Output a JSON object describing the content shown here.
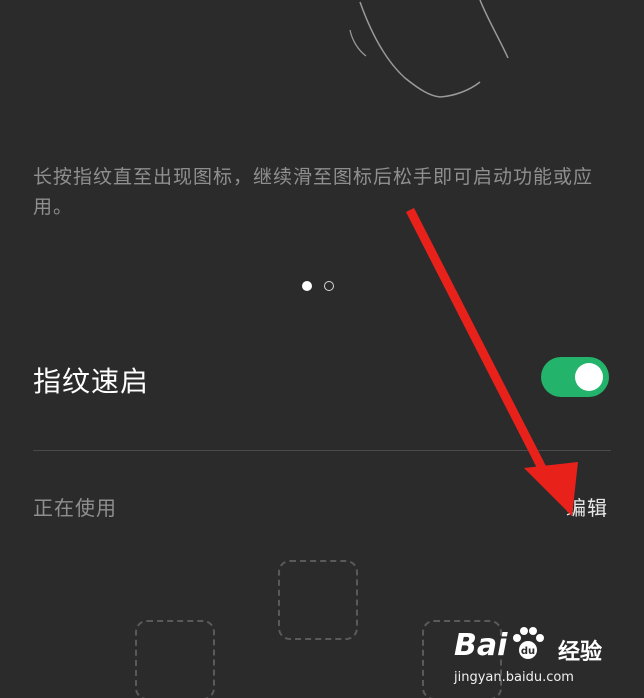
{
  "instruction_text": "长按指纹直至出现图标，继续滑至图标后松手即可启动功能或应用。",
  "pager": {
    "total": 2,
    "current": 1
  },
  "feature": {
    "title": "指纹速启",
    "enabled": true,
    "toggle_color": "#23b36b"
  },
  "in_use": {
    "label": "正在使用",
    "edit_label": "编辑"
  },
  "annotation": {
    "arrow_color": "#e8221b"
  },
  "watermark": {
    "brand_left": "Bai",
    "brand_right": "du",
    "service": "经验",
    "url": "jingyan.baidu.com"
  }
}
